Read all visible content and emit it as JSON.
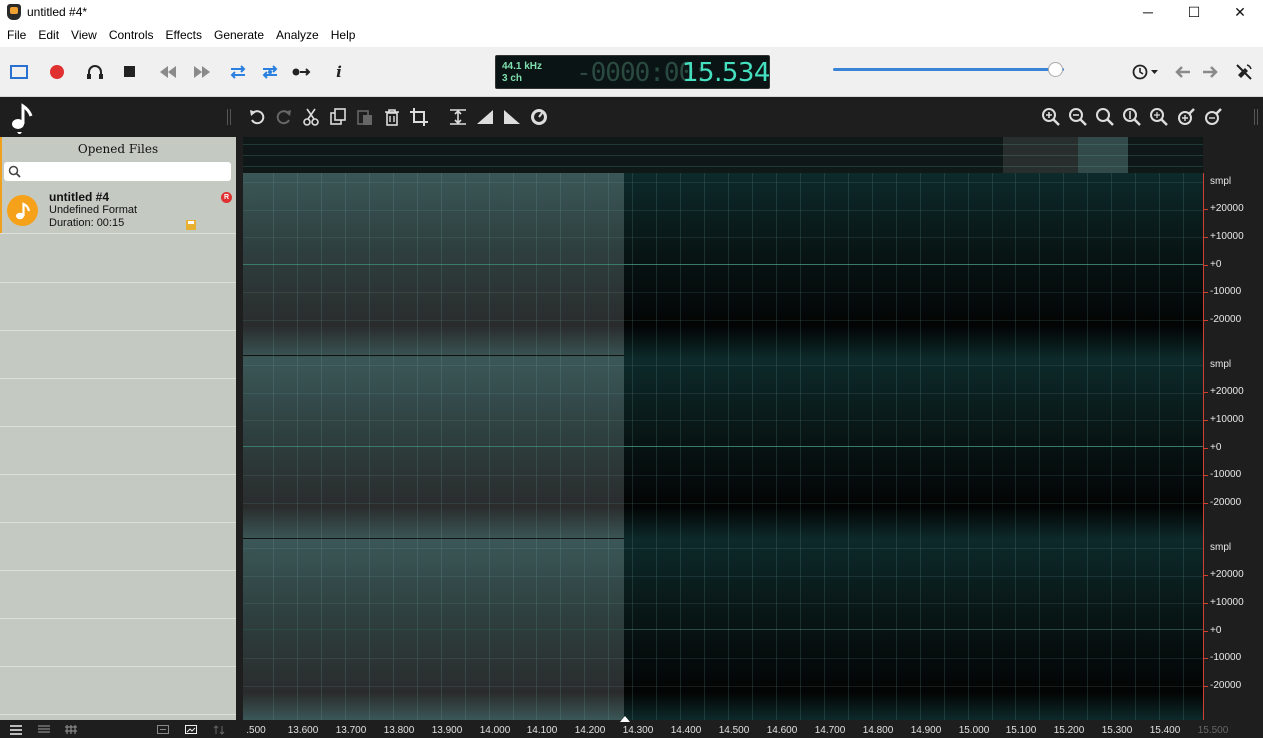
{
  "window": {
    "title": "untitled #4*",
    "minimize": "─",
    "maximize": "☐",
    "close": "✕"
  },
  "menu": [
    "File",
    "Edit",
    "View",
    "Controls",
    "Effects",
    "Generate",
    "Analyze",
    "Help"
  ],
  "toolbar": {
    "buttons": [
      "select-mode",
      "record",
      "monitor",
      "stop",
      "rewind",
      "fast-forward",
      "loop",
      "loop-selection",
      "skip",
      "info"
    ],
    "info_label": "i"
  },
  "display": {
    "sample_rate": "44.1 kHz",
    "channels": "3 ch",
    "time_ghost": "-0000:00:",
    "time": "15.534"
  },
  "volume": {
    "level": 0.93
  },
  "sidebar": {
    "title": "Opened Files",
    "search_placeholder": "",
    "files": [
      {
        "name": "untitled #4",
        "format": "Undefined Format",
        "duration": "Duration: 00:15",
        "badge": "R"
      }
    ]
  },
  "vertical_scale": {
    "unit": "smpl",
    "labels": [
      "+20000",
      "+10000",
      "+0",
      "-10000",
      "-20000"
    ]
  },
  "time_axis": {
    "labels": [
      ".500",
      "13.600",
      "13.700",
      "13.800",
      "13.900",
      "14.000",
      "14.100",
      "14.200",
      "14.300",
      "14.400",
      "14.500",
      "14.600",
      "14.700",
      "14.800",
      "14.900",
      "15.000",
      "15.100",
      "15.200",
      "15.300",
      "15.400",
      "15.500"
    ]
  },
  "colors": {
    "accent": "#3a84d8",
    "record": "#e03030",
    "file_icon": "#f5a21a",
    "time_display": "#45e0c0"
  }
}
